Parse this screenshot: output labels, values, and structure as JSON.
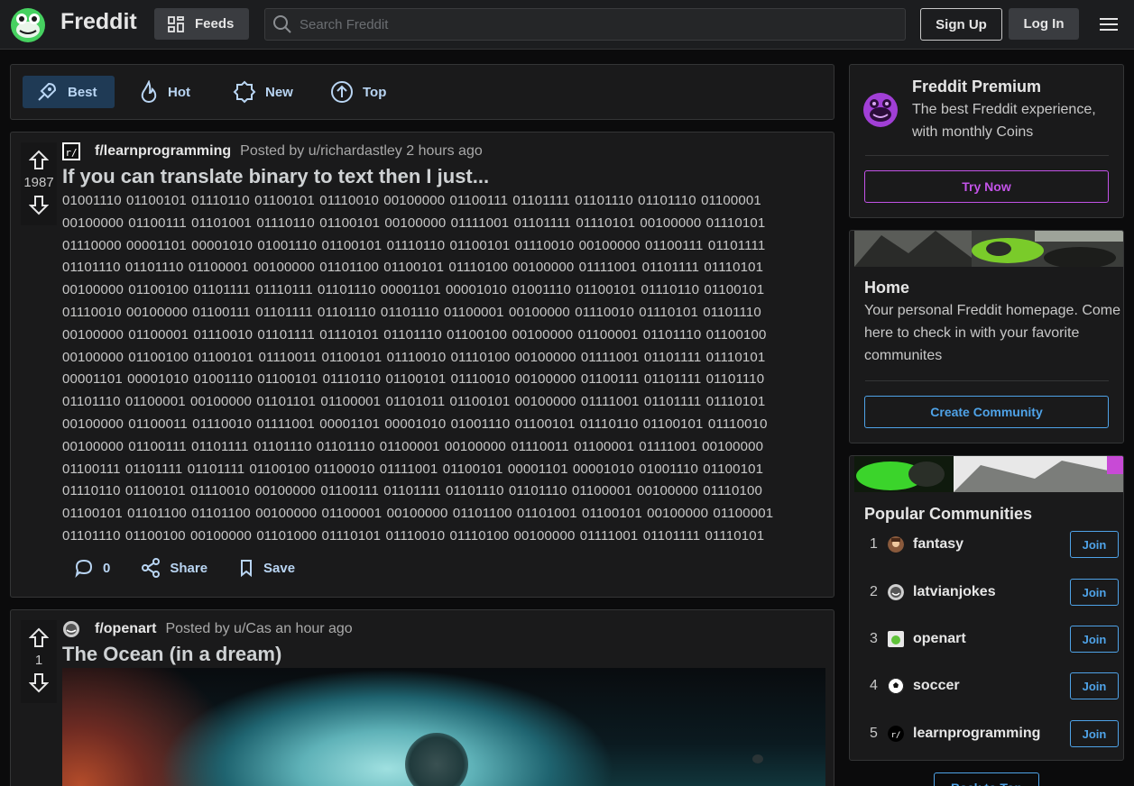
{
  "header": {
    "brand": "Freddit",
    "feeds_label": "Feeds",
    "search_placeholder": "Search Freddit",
    "signup_label": "Sign Up",
    "login_label": "Log In"
  },
  "sort": {
    "items": [
      {
        "label": "Best",
        "icon": "rocket-icon",
        "active": true
      },
      {
        "label": "Hot",
        "icon": "flame-icon",
        "active": false
      },
      {
        "label": "New",
        "icon": "badge-icon",
        "active": false
      },
      {
        "label": "Top",
        "icon": "arrow-up-circle-icon",
        "active": false
      }
    ]
  },
  "posts": [
    {
      "subreddit": "f/learnprogramming",
      "posted_by": "Posted by u/richardastley 2 hours ago",
      "votes": "1987",
      "title": "If you can translate binary to text then I just...",
      "body": "01001110 01100101 01110110 01100101 01110010 00100000 01100111 01101111 01101110 01101110 01100001 00100000 01100111 01101001 01110110 01100101 00100000 01111001 01101111 01110101 00100000 01110101 01110000 00001101 00001010 01001110 01100101 01110110 01100101 01110010 00100000 01100111 01101111 01101110 01101110 01100001 00100000 01101100 01100101 01110100 00100000 01111001 01101111 01110101 00100000 01100100 01101111 01110111 01101110 00001101 00001010 01001110 01100101 01110110 01100101 01110010 00100000 01100111 01101111 01101110 01101110 01100001 00100000 01110010 01110101 01101110 00100000 01100001 01110010 01101111 01110101 01101110 01100100 00100000 01100001 01101110 01100100 00100000 01100100 01100101 01110011 01100101 01110010 01110100 00100000 01111001 01101111 01110101 00001101 00001010 01001110 01100101 01110110 01100101 01110010 00100000 01100111 01101111 01101110 01101110 01100001 00100000 01101101 01100001 01101011 01100101 00100000 01111001 01101111 01110101 00100000 01100011 01110010 01111001 00001101 00001010 01001110 01100101 01110110 01100101 01110010 00100000 01100111 01101111 01101110 01101110 01100001 00100000 01110011 01100001 01111001 00100000 01100111 01101111 01101111 01100100 01100010 01111001 01100101 00001101 00001010 01001110 01100101 01110110 01100101 01110010 00100000 01100111 01101111 01101110 01101110 01100001 00100000 01110100 01100101 01101100 01101100 00100000 01100001 00100000 01101100 01101001 01100101 00100000 01100001 01101110 01100100 00100000 01101000 01110101 01110010 01110100 00100000 01111001 01101111 01110101",
      "comments": "0",
      "share_label": "Share",
      "save_label": "Save"
    },
    {
      "subreddit": "f/openart",
      "posted_by": "Posted by u/Cas an hour ago",
      "votes": "1",
      "title": "The Ocean (in a dream)"
    }
  ],
  "premium": {
    "title": "Freddit Premium",
    "description": "The best Freddit experience, with monthly Coins",
    "button": "Try Now"
  },
  "home": {
    "title": "Home",
    "description": "Your personal Freddit homepage. Come here to check in with your favorite communites",
    "button": "Create Community"
  },
  "popular": {
    "title": "Popular Communities",
    "join_label": "Join",
    "communities": [
      {
        "rank": "1",
        "name": "fantasy"
      },
      {
        "rank": "2",
        "name": "latvianjokes"
      },
      {
        "rank": "3",
        "name": "openart"
      },
      {
        "rank": "4",
        "name": "soccer"
      },
      {
        "rank": "5",
        "name": "learnprogramming"
      }
    ]
  },
  "back_to_top": "Back to Top",
  "colors": {
    "accent_blue": "#4fa3e8",
    "premium_purple": "#c353e8",
    "brand_green": "#46d160"
  }
}
